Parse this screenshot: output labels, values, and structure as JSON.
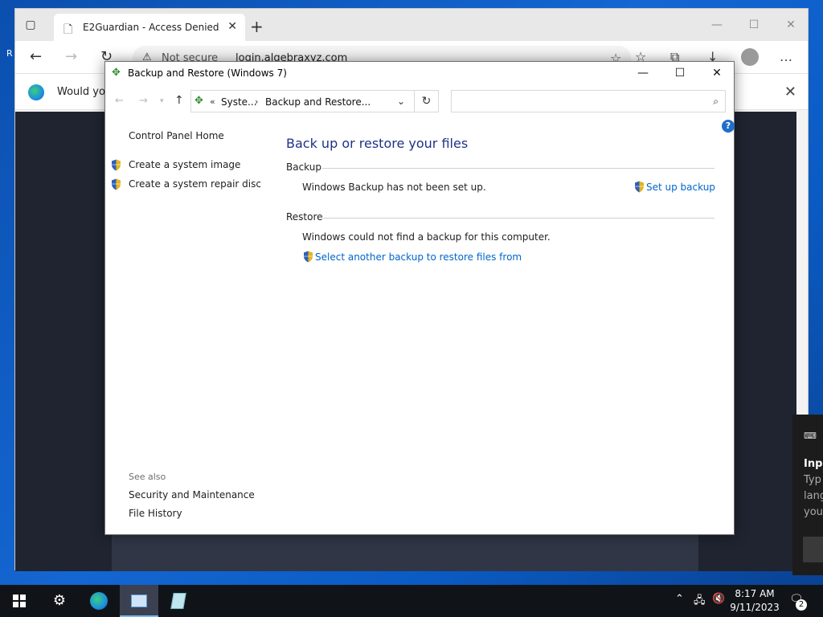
{
  "desktop": {
    "edge_char": "R"
  },
  "browser": {
    "tab_title": "E2Guardian - Access Denied",
    "not_secure": "Not secure",
    "url": "login.algebraxyz.com",
    "info_text": "Would you"
  },
  "window": {
    "title": "Backup and Restore (Windows 7)",
    "breadcrumb": {
      "chevrons": "«",
      "part1": "Syste...",
      "part2": "Backup and Restore..."
    },
    "search_placeholder": "",
    "left_nav": {
      "home": "Control Panel Home",
      "links": [
        "Create a system image",
        "Create a system repair disc"
      ],
      "see_also_label": "See also",
      "see_also": [
        "Security and Maintenance",
        "File History"
      ]
    },
    "main": {
      "heading": "Back up or restore your files",
      "backup_label": "Backup",
      "backup_status": "Windows Backup has not been set up.",
      "setup_link": "Set up backup",
      "restore_label": "Restore",
      "restore_status": "Windows could not find a backup for this computer.",
      "restore_link": "Select another backup to restore files from"
    }
  },
  "notification": {
    "title": "Inpu",
    "lines": [
      "Typ",
      "lang",
      "you"
    ]
  },
  "taskbar": {
    "time": "8:17 AM",
    "date": "9/11/2023",
    "notification_count": "2"
  }
}
